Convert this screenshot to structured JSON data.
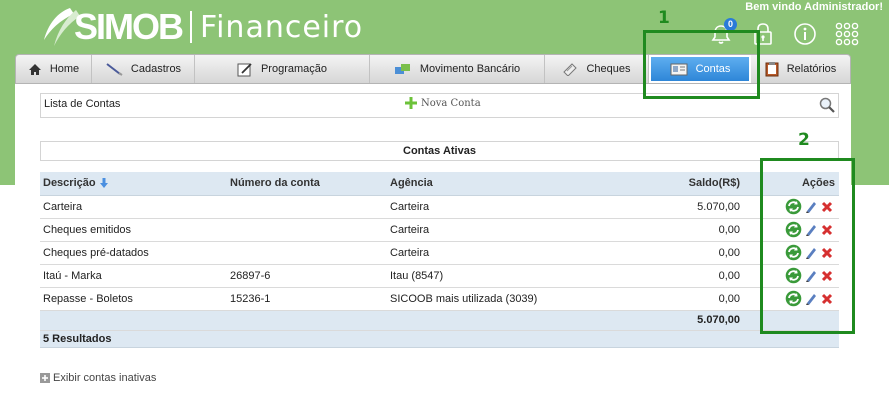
{
  "header": {
    "logo_brand": "SIMOB",
    "logo_product": "Financeiro",
    "welcome": "Bem vindo Administrador!",
    "notification_count": "0"
  },
  "nav": {
    "items": [
      {
        "label": "Home",
        "icon": "home-icon"
      },
      {
        "label": "Cadastros",
        "icon": "pen-icon"
      },
      {
        "label": "Programação",
        "icon": "edit-icon"
      },
      {
        "label": "Movimento Bancário",
        "icon": "transfer-icon"
      },
      {
        "label": "Cheques",
        "icon": "check-icon"
      },
      {
        "label": "Contas",
        "icon": "id-card-icon",
        "active": true
      },
      {
        "label": "Relatórios",
        "icon": "clipboard-icon"
      }
    ]
  },
  "annotations": [
    "1",
    "2"
  ],
  "toolbar": {
    "list_title": "Lista de Contas",
    "new_account": "Nova Conta"
  },
  "section_title": "Contas Ativas",
  "table": {
    "headers": {
      "description": "Descrição",
      "account_number": "Número da conta",
      "agency": "Agência",
      "balance": "Saldo(R$)",
      "actions": "Ações"
    },
    "rows": [
      {
        "description": "Carteira",
        "account_number": "",
        "agency": "Carteira",
        "balance": "5.070,00"
      },
      {
        "description": "Cheques emitidos",
        "account_number": "",
        "agency": "Carteira",
        "balance": "0,00"
      },
      {
        "description": "Cheques pré-datados",
        "account_number": "",
        "agency": "Carteira",
        "balance": "0,00"
      },
      {
        "description": "Itaú - Marka",
        "account_number": "26897-6",
        "agency": "Itau (8547)",
        "balance": "0,00"
      },
      {
        "description": "Repasse - Boletos",
        "account_number": "15236-1",
        "agency": "SICOOB mais utilizada (3039)",
        "balance": "0,00"
      }
    ],
    "total": "5.070,00",
    "results": "5 Resultados"
  },
  "show_inactive": "Exibir contas inativas",
  "colors": {
    "header_bg": "#8dc476",
    "active_tab": "#2e86d8",
    "annotation": "#1f8a1f",
    "table_header": "#dde8f2"
  }
}
